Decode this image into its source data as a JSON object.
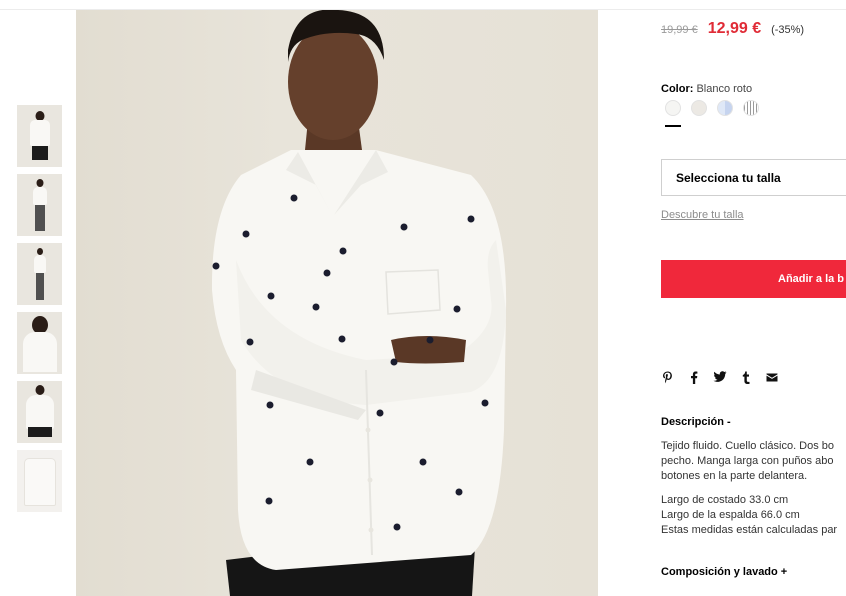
{
  "product": {
    "old_price": "19,99 €",
    "new_price": "12,99 €",
    "discount": "(-35%)",
    "color_label": "Color:",
    "color_value": "Blanco roto",
    "swatch_colors": [
      "#f5f5f3",
      "#ece9e4",
      "#c6d4ef",
      "#9a9a9a"
    ]
  },
  "size": {
    "select_label": "Selecciona tu talla",
    "guide_link": "Descubre tu talla"
  },
  "cart": {
    "add_label": "Añadir a la b"
  },
  "share": {
    "icons": [
      "pinterest-icon",
      "facebook-icon",
      "twitter-icon",
      "tumblr-icon",
      "email-icon"
    ]
  },
  "description": {
    "title": "Descripción -",
    "lines": [
      "Tejido fluido. Cuello clásico. Dos bo",
      "pecho. Manga larga con puños abo",
      "botones en la parte delantera."
    ],
    "measures": [
      "Largo de costado 33.0 cm",
      "Largo de la espalda 66.0 cm",
      "Estas medidas están calculadas par"
    ]
  },
  "composition": {
    "title": "Composición y lavado +"
  },
  "colors": {
    "accent": "#f0283b",
    "sale_price": "#e02b36"
  }
}
